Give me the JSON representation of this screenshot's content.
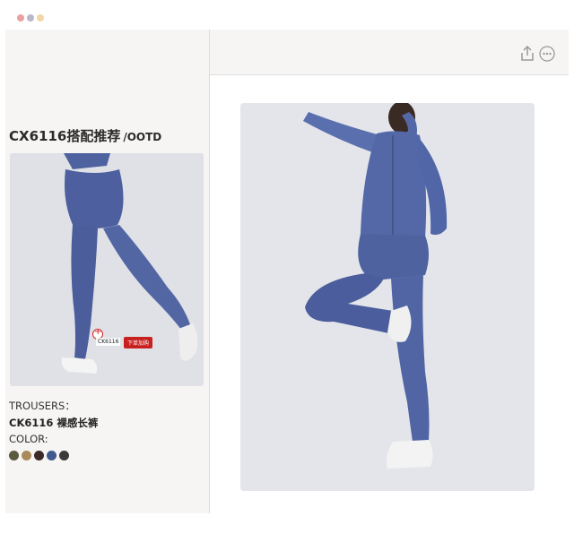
{
  "window": {
    "dots": [
      "#e9a0a0",
      "#b8b8c8",
      "#f2d6a6"
    ]
  },
  "outfit": {
    "code_title": "CX6116搭配推荐",
    "tag": "/OOTD"
  },
  "product": {
    "hotspot_code": "CK6116",
    "order_button": "下单加购",
    "trousers_label": "TROUSERS：",
    "trousers_name": "CK6116 裸感长裤",
    "color_label": "COLOR:",
    "colors": [
      "#5a5a3f",
      "#a98a5c",
      "#3b2a28",
      "#3f5a8e",
      "#3a3a3a"
    ]
  },
  "colors": {
    "legging_blue": "#4f62a0",
    "panel_bg": "#f7f5f3",
    "accent_red": "#c8201f"
  },
  "icons": {
    "share": "share-icon",
    "more": "more-options-icon"
  }
}
